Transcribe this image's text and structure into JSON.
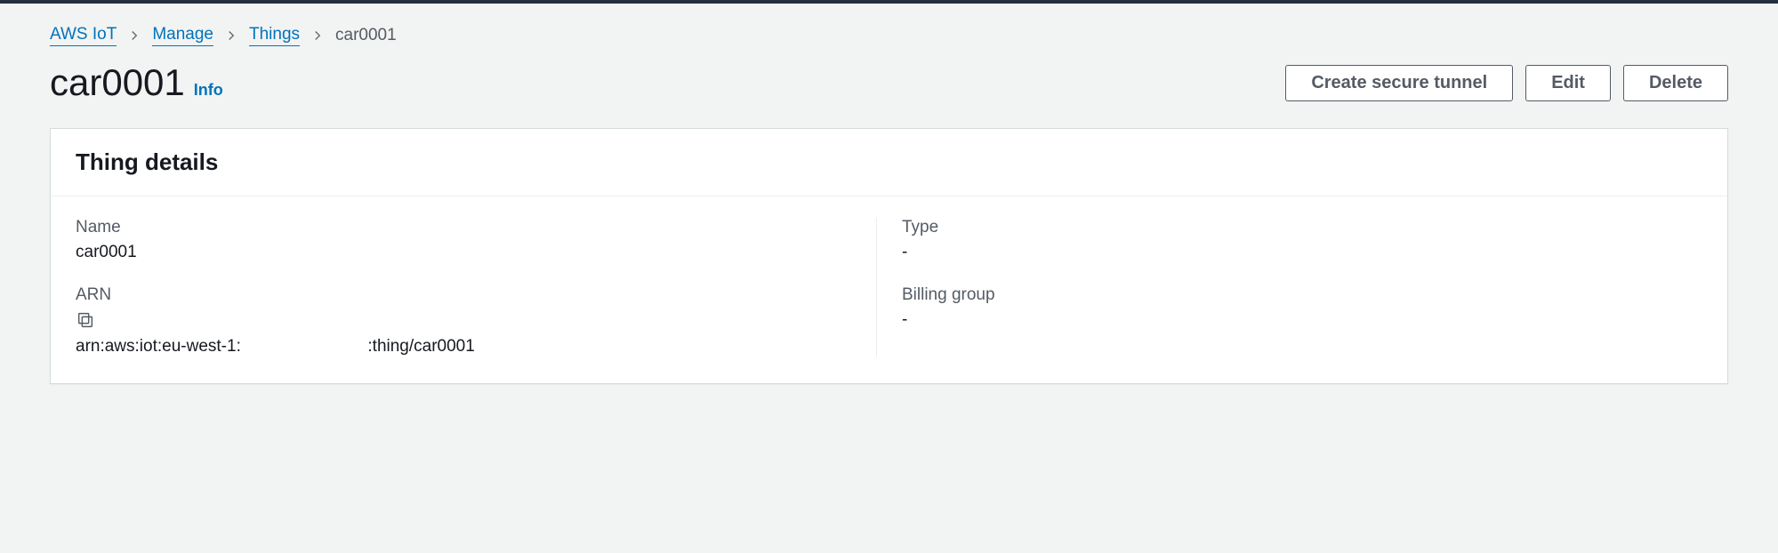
{
  "breadcrumb": {
    "items": [
      {
        "label": "AWS IoT",
        "link": true
      },
      {
        "label": "Manage",
        "link": true
      },
      {
        "label": "Things",
        "link": true
      },
      {
        "label": "car0001",
        "link": false
      }
    ]
  },
  "header": {
    "title": "car0001",
    "info_label": "Info",
    "actions": {
      "create_tunnel": "Create secure tunnel",
      "edit": "Edit",
      "delete": "Delete"
    }
  },
  "panel": {
    "title": "Thing details",
    "fields": {
      "name_label": "Name",
      "name_value": "car0001",
      "arn_label": "ARN",
      "arn_value": "arn:aws:iot:eu-west-1:                           :thing/car0001",
      "type_label": "Type",
      "type_value": "-",
      "billing_group_label": "Billing group",
      "billing_group_value": "-"
    }
  }
}
